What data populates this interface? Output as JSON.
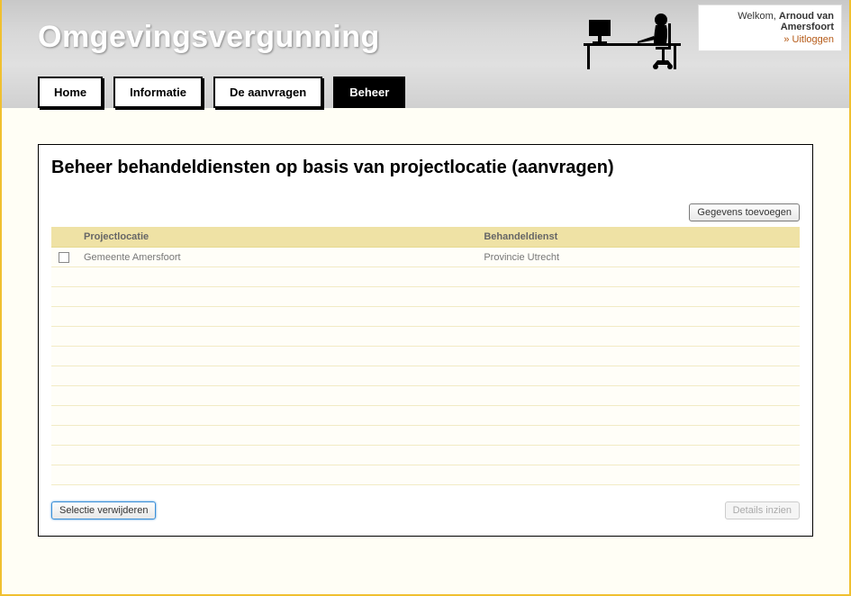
{
  "header": {
    "title": "Omgevingsvergunning",
    "welcome_prefix": "Welkom, ",
    "username": "Arnoud van Amersfoort",
    "logout_label": "Uitloggen"
  },
  "nav": {
    "tabs": [
      {
        "label": "Home",
        "active": false
      },
      {
        "label": "Informatie",
        "active": false
      },
      {
        "label": "De aanvragen",
        "active": false
      },
      {
        "label": "Beheer",
        "active": true
      }
    ]
  },
  "panel": {
    "title": "Beheer behandeldiensten op basis van projectlocatie (aanvragen)",
    "add_button": "Gegevens toevoegen",
    "delete_button": "Selectie verwijderen",
    "details_button": "Details inzien",
    "columns": {
      "projectlocatie": "Projectlocatie",
      "behandeldienst": "Behandeldienst"
    },
    "rows": [
      {
        "projectlocatie": "Gemeente Amersfoort",
        "behandeldienst": "Provincie Utrecht"
      }
    ],
    "empty_row_count": 11
  }
}
